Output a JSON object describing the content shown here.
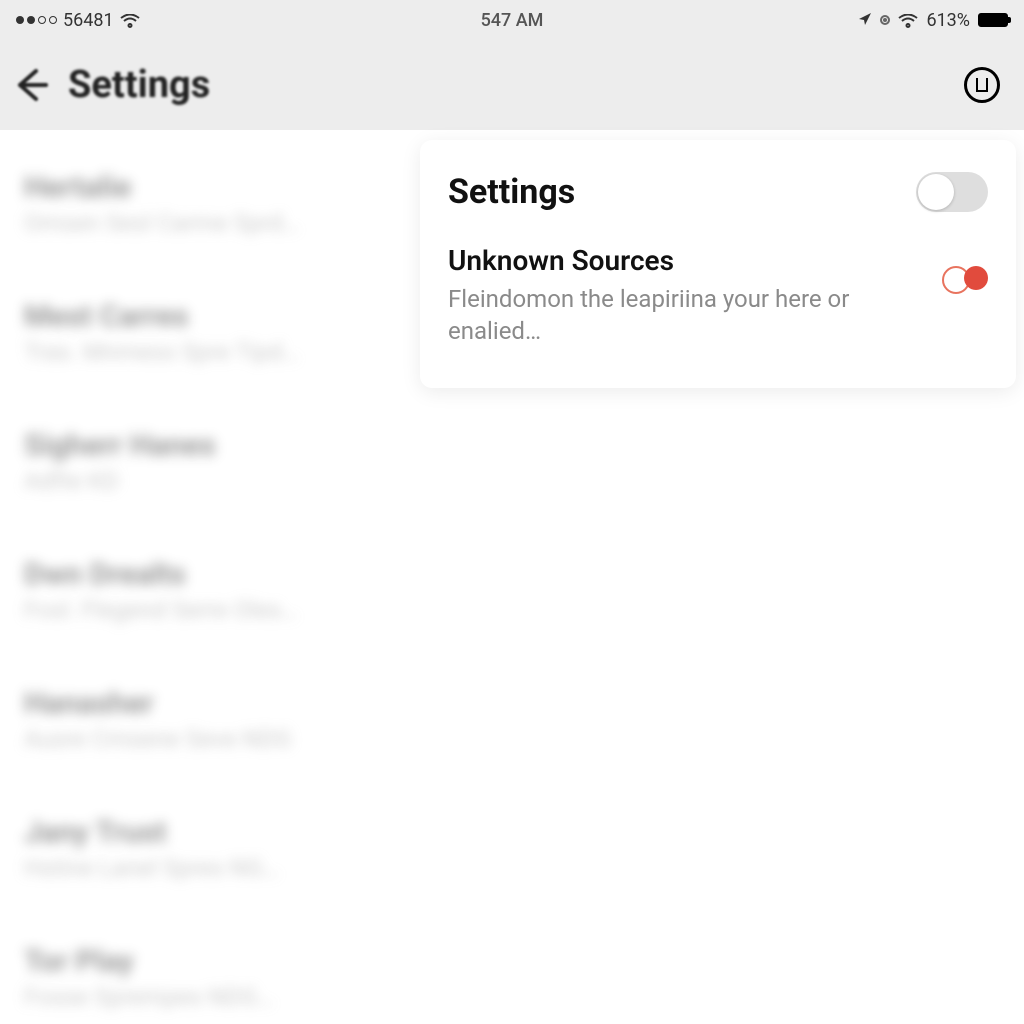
{
  "status_bar": {
    "carrier": "56481",
    "time": "547 AM",
    "battery_text": "613%"
  },
  "nav": {
    "title": "Settings"
  },
  "sidebar": {
    "items": [
      {
        "title": "Hertalie",
        "subtitle": "Omsen Sesl Carme Sprd…"
      },
      {
        "title": "Mest Carres",
        "subtitle": "Tras. Mnmess Spre Tipd…"
      },
      {
        "title": "Sigherr Hanes",
        "subtitle": "Adfte KD"
      },
      {
        "title": "Dwn Drealts",
        "subtitle": "Fosl. Flegend Serre Oles…"
      },
      {
        "title": "Hanasher",
        "subtitle": "Ausre Cmsene Seve NDG"
      },
      {
        "title": "Jany Trust",
        "subtitle": "Hstine Lanel Spres NG…"
      },
      {
        "title": "Tor Play",
        "subtitle": "Fosse Sprempes NDG…"
      }
    ]
  },
  "panel": {
    "header": "Settings",
    "toggle_main": false,
    "setting": {
      "title": "Unknown Sources",
      "description": "Fleindomon the leapiriina your here or enalied…",
      "enabled": true
    }
  }
}
